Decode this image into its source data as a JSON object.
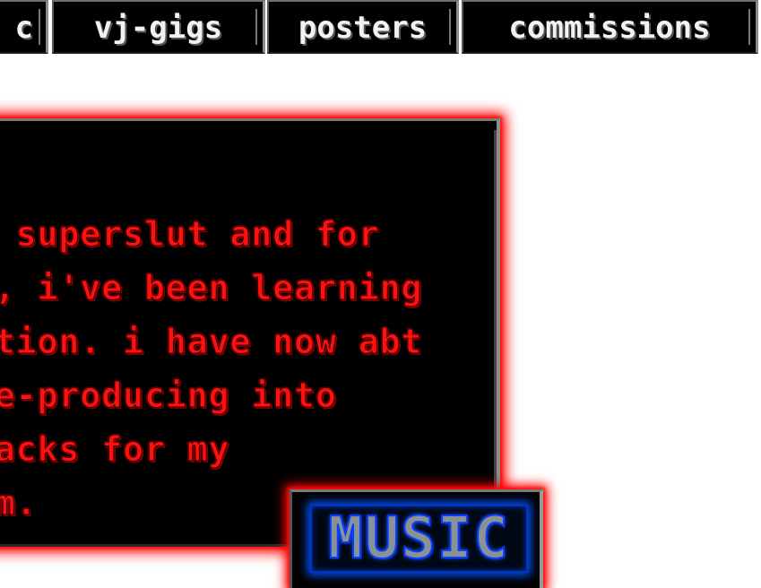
{
  "nav": {
    "tabs": [
      {
        "label": "c"
      },
      {
        "label": "vj-gigs"
      },
      {
        "label": "posters"
      },
      {
        "label": "commissions"
      }
    ]
  },
  "panel": {
    "lines": [
      "a superslut and for",
      "s, i've been learning",
      "ction. i have now abt",
      "re-producing into",
      "racks for my",
      "um."
    ]
  },
  "music_button": {
    "label": "MUSIC"
  },
  "colors": {
    "page_background": "#ffffff",
    "tab_background": "#000000",
    "tab_text": "#f2f2f2",
    "panel_text": "#ff1010",
    "panel_glow": "#ff0000",
    "music_outline": "#0a3dff",
    "music_fill": "#8a9393"
  }
}
